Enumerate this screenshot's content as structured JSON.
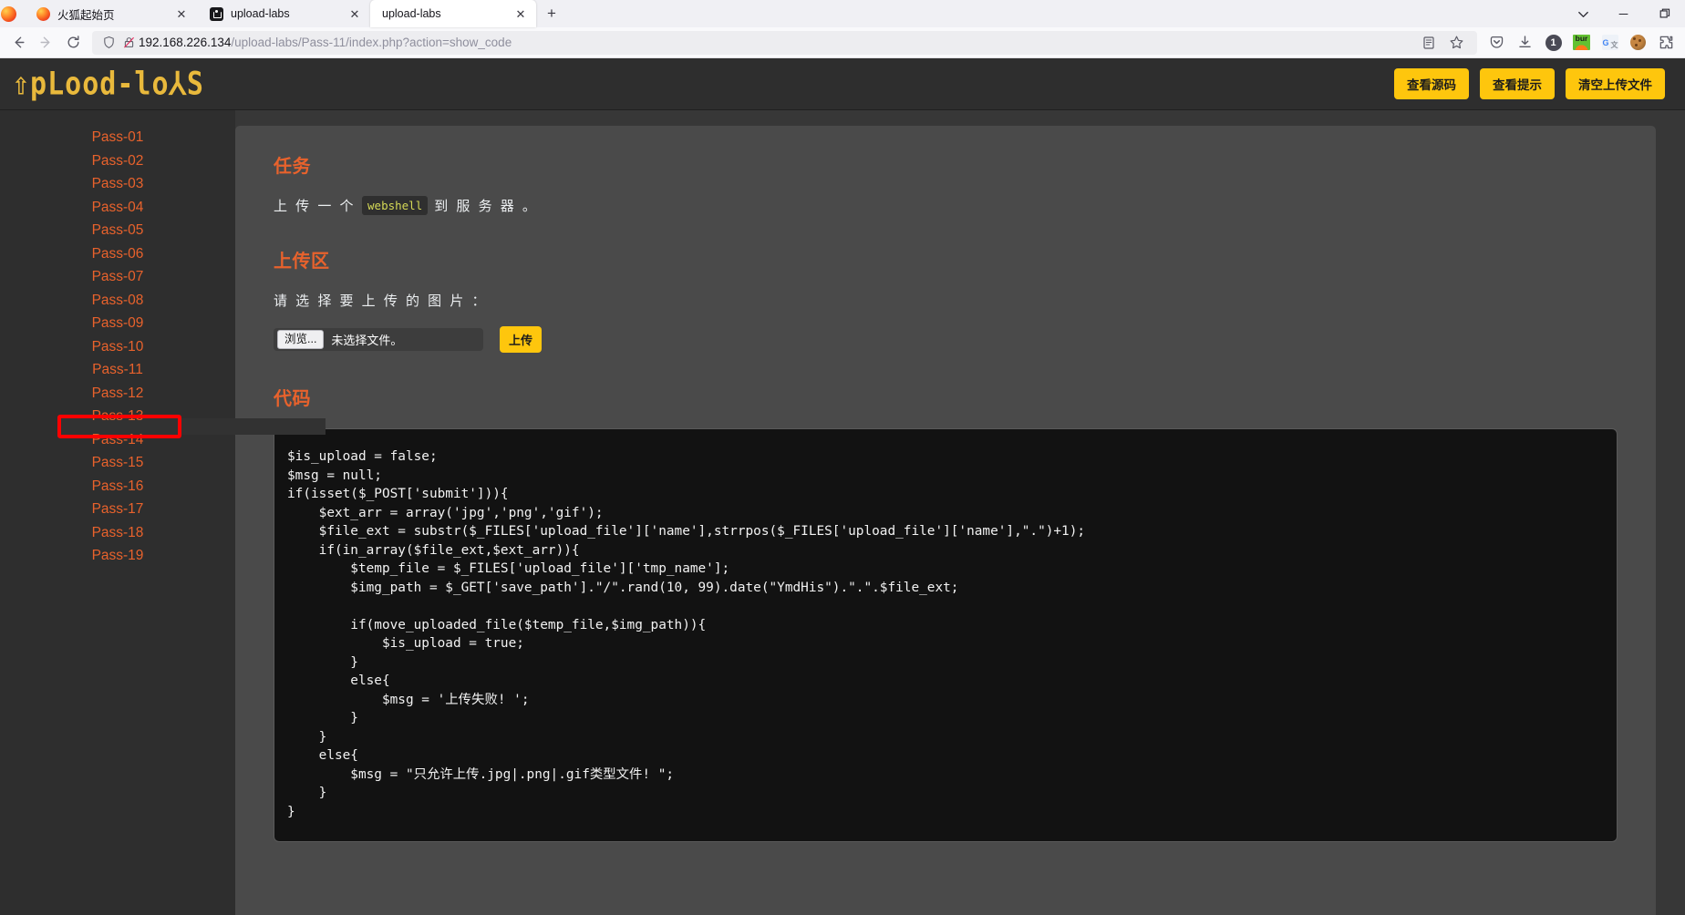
{
  "browser": {
    "tabs": [
      {
        "title": "火狐起始页",
        "favicon": "firefox-icon",
        "active": false
      },
      {
        "title": "upload-labs",
        "favicon": "site-icon",
        "active": false
      },
      {
        "title": "upload-labs",
        "favicon": "none",
        "active": true
      }
    ],
    "new_tab_label": "+",
    "close_label": "✕",
    "window_controls": {
      "minimize": "—",
      "restore": "❐",
      "list_all_tabs": "⌄"
    },
    "url": {
      "domain": "192.168.226.134",
      "path": "/upload-labs/Pass-11/index.php?action=show_code"
    },
    "toolbar_icons": [
      "shield-icon",
      "insecure-lock-icon",
      "reader-view-icon",
      "bookmark-star-icon",
      "pocket-icon",
      "downloads-icon",
      "account-badge-icon",
      "burp-extension-icon",
      "google-translate-extension-icon",
      "cookie-extension-icon",
      "extensions-puzzle-icon"
    ],
    "badge_count": "1",
    "burp_label": "bur",
    "translate_label": "G"
  },
  "site": {
    "logo_text": "⇧pLood-lo⅄S",
    "header_buttons": [
      {
        "label": "查看源码",
        "name": "view-source-button"
      },
      {
        "label": "查看提示",
        "name": "view-hint-button"
      },
      {
        "label": "清空上传文件",
        "name": "clear-uploads-button"
      }
    ]
  },
  "sidebar": {
    "items": [
      "Pass-01",
      "Pass-02",
      "Pass-03",
      "Pass-04",
      "Pass-05",
      "Pass-06",
      "Pass-07",
      "Pass-08",
      "Pass-09",
      "Pass-10",
      "Pass-11",
      "Pass-12",
      "Pass-13",
      "Pass-14",
      "Pass-15",
      "Pass-16",
      "Pass-17",
      "Pass-18",
      "Pass-19"
    ],
    "current": "Pass-11",
    "annotation_color": "#ff0000"
  },
  "main": {
    "task_heading": "任务",
    "task_text_before": "上 传 一 个",
    "task_code": "webshell",
    "task_text_after": "到 服 务 器 。",
    "upload_heading": "上传区",
    "upload_label": "请 选 择 要 上 传 的 图 片 ：",
    "browse_button": "浏览...",
    "file_status": "未选择文件。",
    "submit_button": "上传",
    "code_heading": "代码",
    "code": "$is_upload = false;\n$msg = null;\nif(isset($_POST['submit'])){\n    $ext_arr = array('jpg','png','gif');\n    $file_ext = substr($_FILES['upload_file']['name'],strrpos($_FILES['upload_file']['name'],\".\")+1);\n    if(in_array($file_ext,$ext_arr)){\n        $temp_file = $_FILES['upload_file']['tmp_name'];\n        $img_path = $_GET['save_path'].\"/\".rand(10, 99).date(\"YmdHis\").\".\".$file_ext;\n\n        if(move_uploaded_file($temp_file,$img_path)){\n            $is_upload = true;\n        }\n        else{\n            $msg = '上传失败! ';\n        }\n    }\n    else{\n        $msg = \"只允许上传.jpg|.png|.gif类型文件! \";\n    }\n}"
  },
  "colors": {
    "accent_orange": "#e8622c",
    "accent_yellow": "#fec60d",
    "page_bg": "#373737",
    "card_bg": "#4a4a4a",
    "code_bg": "#121212"
  }
}
